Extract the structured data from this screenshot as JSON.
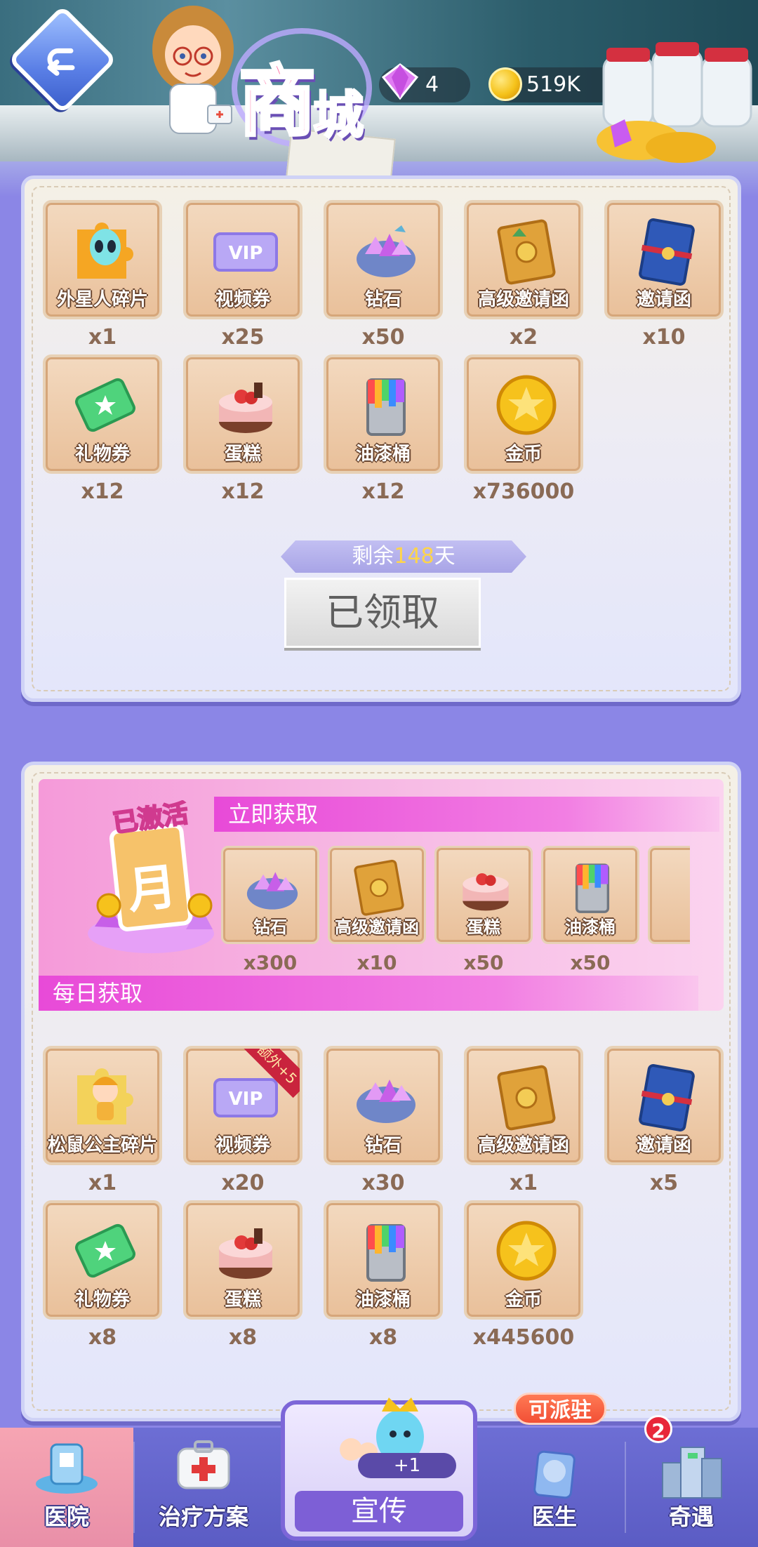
{
  "header": {
    "title_char1": "商",
    "title_char2": "城",
    "gems": "4",
    "coins": "519K"
  },
  "card1": {
    "row1": [
      {
        "label": "外星人碎片",
        "qty": "x1",
        "icon": "alien-puzzle-icon"
      },
      {
        "label": "视频券",
        "qty": "x25",
        "icon": "vip-ticket-icon"
      },
      {
        "label": "钻石",
        "qty": "x50",
        "icon": "diamond-box-icon"
      },
      {
        "label": "高级邀请函",
        "qty": "x2",
        "icon": "gold-invite-icon"
      },
      {
        "label": "邀请函",
        "qty": "x10",
        "icon": "blue-invite-icon"
      }
    ],
    "row2": [
      {
        "label": "礼物券",
        "qty": "x12",
        "icon": "gift-ticket-icon"
      },
      {
        "label": "蛋糕",
        "qty": "x12",
        "icon": "cake-icon"
      },
      {
        "label": "油漆桶",
        "qty": "x12",
        "icon": "paint-bucket-icon"
      },
      {
        "label": "金币",
        "qty": "x736000",
        "icon": "gold-coin-icon"
      }
    ],
    "remain_prefix": "剩余",
    "remain_days": "148",
    "remain_suffix": "天",
    "claimed_label": "已领取"
  },
  "card2": {
    "pass_badge": "已激活",
    "pass_name": "月",
    "instant_title": "立即获取",
    "instant": [
      {
        "label": "钻石",
        "qty": "x300",
        "icon": "diamond-box-icon"
      },
      {
        "label": "高级邀请函",
        "qty": "x10",
        "icon": "gold-invite-icon"
      },
      {
        "label": "蛋糕",
        "qty": "x50",
        "icon": "cake-icon"
      },
      {
        "label": "油漆桶",
        "qty": "x50",
        "icon": "paint-bucket-icon"
      }
    ],
    "daily_title": "每日获取",
    "extra_ribbon": "额外+5",
    "row1": [
      {
        "label": "松鼠公主碎片",
        "qty": "x1",
        "icon": "squirrel-princess-puzzle-icon"
      },
      {
        "label": "视频券",
        "qty": "x20",
        "icon": "vip-ticket-icon"
      },
      {
        "label": "钻石",
        "qty": "x30",
        "icon": "diamond-box-icon"
      },
      {
        "label": "高级邀请函",
        "qty": "x1",
        "icon": "gold-invite-icon"
      },
      {
        "label": "邀请函",
        "qty": "x5",
        "icon": "blue-invite-icon"
      }
    ],
    "row2": [
      {
        "label": "礼物券",
        "qty": "x8",
        "icon": "gift-ticket-icon"
      },
      {
        "label": "蛋糕",
        "qty": "x8",
        "icon": "cake-icon"
      },
      {
        "label": "油漆桶",
        "qty": "x8",
        "icon": "paint-bucket-icon"
      },
      {
        "label": "金币",
        "qty": "x445600",
        "icon": "gold-coin-icon"
      }
    ]
  },
  "nav": {
    "hospital": "医院",
    "plan": "治疗方案",
    "promo": "宣传",
    "promo_plus": "+1",
    "doctor": "医生",
    "doctor_badge": "可派驻",
    "event": "奇遇",
    "event_count": "2"
  }
}
